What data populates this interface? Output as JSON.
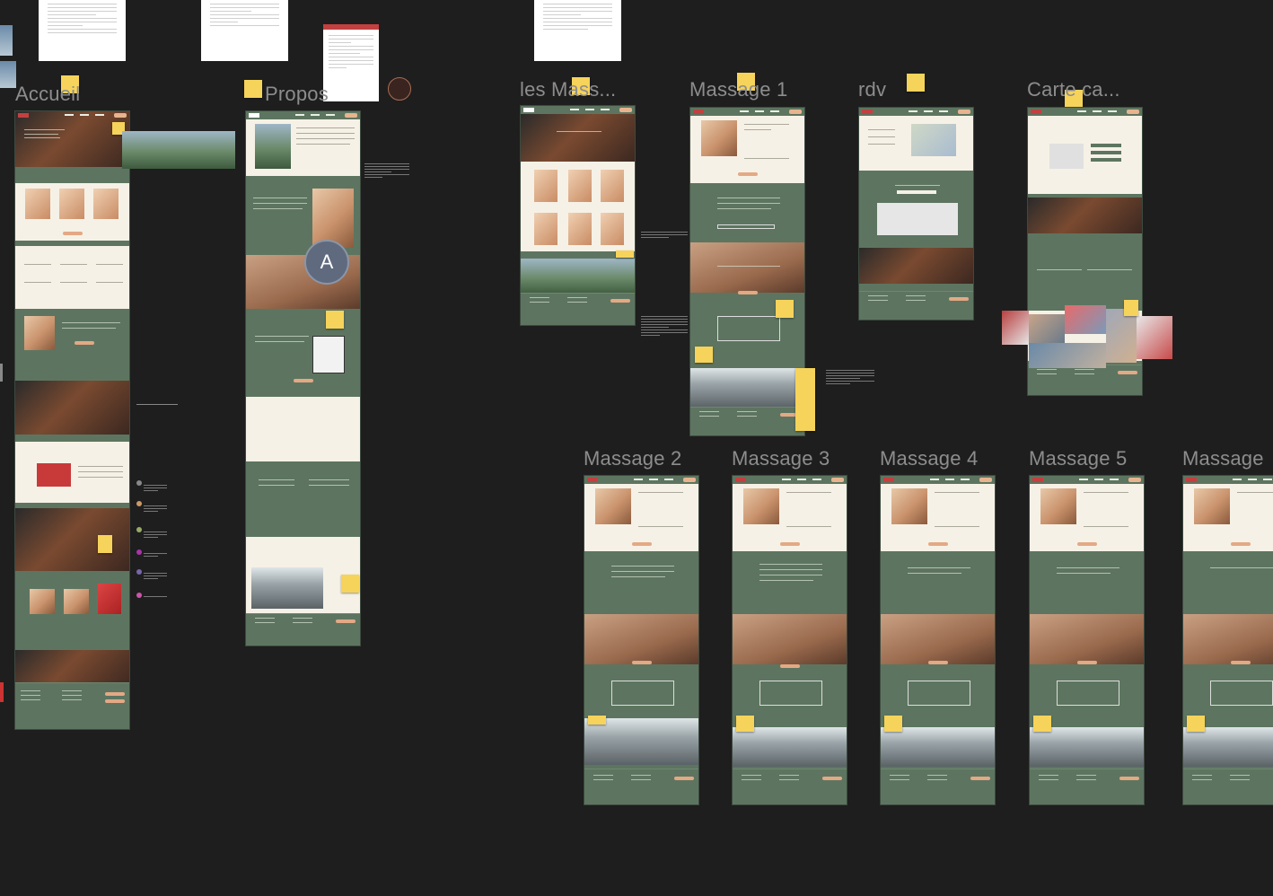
{
  "canvas": {
    "background": "#1e1e1e",
    "brand_green": "#5d7560",
    "cream": "#f6f1e6",
    "accent_peach": "#e3a985",
    "sticky_yellow": "#f6d35a"
  },
  "frames": [
    {
      "id": "accueil",
      "label": "Accueil"
    },
    {
      "id": "propos",
      "label": "Propos"
    },
    {
      "id": "les-massages",
      "label": "les Mass..."
    },
    {
      "id": "massage-1",
      "label": "Massage 1"
    },
    {
      "id": "rdv",
      "label": "rdv"
    },
    {
      "id": "carte-cadeau",
      "label": "Carte ca..."
    },
    {
      "id": "massage-2",
      "label": "Massage 2"
    },
    {
      "id": "massage-3",
      "label": "Massage 3"
    },
    {
      "id": "massage-4",
      "label": "Massage 4"
    },
    {
      "id": "massage-5",
      "label": "Massage 5"
    },
    {
      "id": "massage-6",
      "label": "Massage"
    }
  ],
  "collaborator": {
    "initial": "A"
  }
}
